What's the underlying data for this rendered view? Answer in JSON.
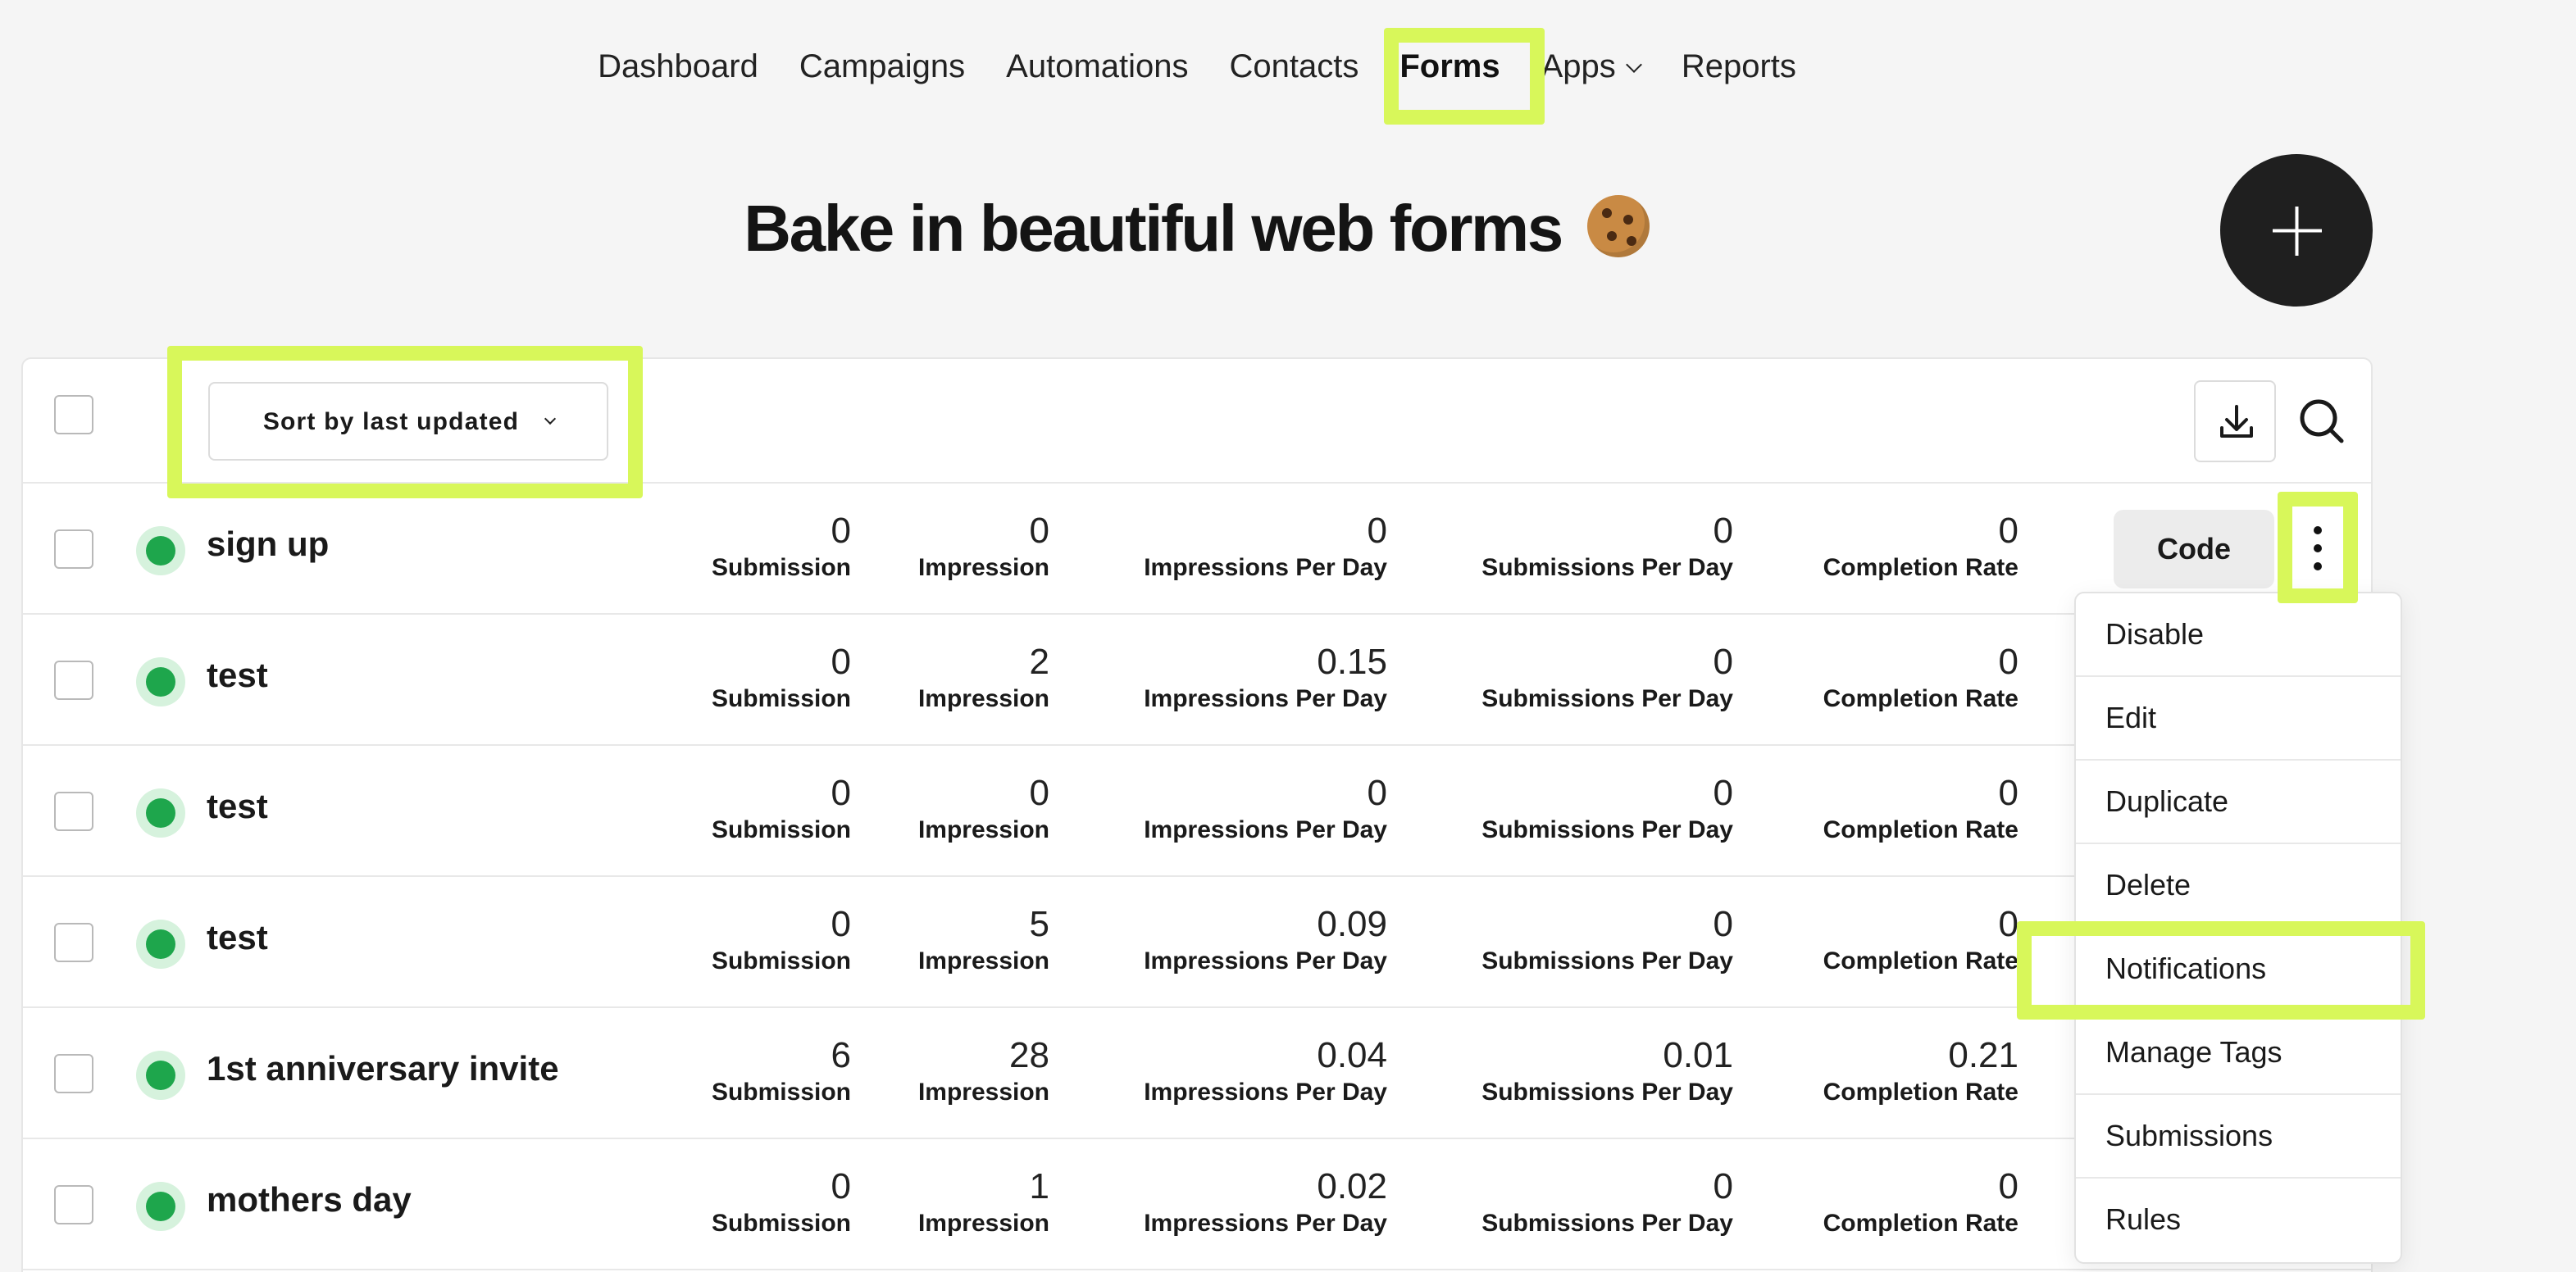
{
  "nav": {
    "items": [
      {
        "label": "Dashboard"
      },
      {
        "label": "Campaigns"
      },
      {
        "label": "Automations"
      },
      {
        "label": "Contacts"
      },
      {
        "label": "Forms",
        "active": true
      },
      {
        "label": "Apps",
        "dropdown": true
      },
      {
        "label": "Reports"
      }
    ]
  },
  "page": {
    "title": "Bake in beautiful web forms",
    "title_icon": "cookie-icon"
  },
  "toolbar": {
    "sort_label": "Sort by last updated",
    "download_icon": "download-icon",
    "search_icon": "search-icon"
  },
  "metric_labels": [
    "Submission",
    "Impression",
    "Impressions Per Day",
    "Submissions Per Day",
    "Completion Rate"
  ],
  "forms": [
    {
      "name": "sign up",
      "status": "active",
      "values": [
        "0",
        "0",
        "0",
        "0",
        "0"
      ],
      "code_label": "Code"
    },
    {
      "name": "test",
      "status": "active",
      "values": [
        "0",
        "2",
        "0.15",
        "0",
        "0"
      ]
    },
    {
      "name": "test",
      "status": "active",
      "values": [
        "0",
        "0",
        "0",
        "0",
        "0"
      ]
    },
    {
      "name": "test",
      "status": "active",
      "values": [
        "0",
        "5",
        "0.09",
        "0",
        "0"
      ]
    },
    {
      "name": "1st anniversary invite",
      "status": "active",
      "values": [
        "6",
        "28",
        "0.04",
        "0.01",
        "0.21"
      ]
    },
    {
      "name": "mothers day",
      "status": "active",
      "values": [
        "0",
        "1",
        "0.02",
        "0",
        "0"
      ]
    }
  ],
  "context_menu": {
    "items": [
      "Disable",
      "Edit",
      "Duplicate",
      "Delete",
      "Notifications",
      "Manage Tags",
      "Submissions",
      "Rules"
    ]
  },
  "colors": {
    "highlight": "#d8f75a",
    "status_active": "#1ea64c",
    "fab": "#1f1f1f"
  }
}
